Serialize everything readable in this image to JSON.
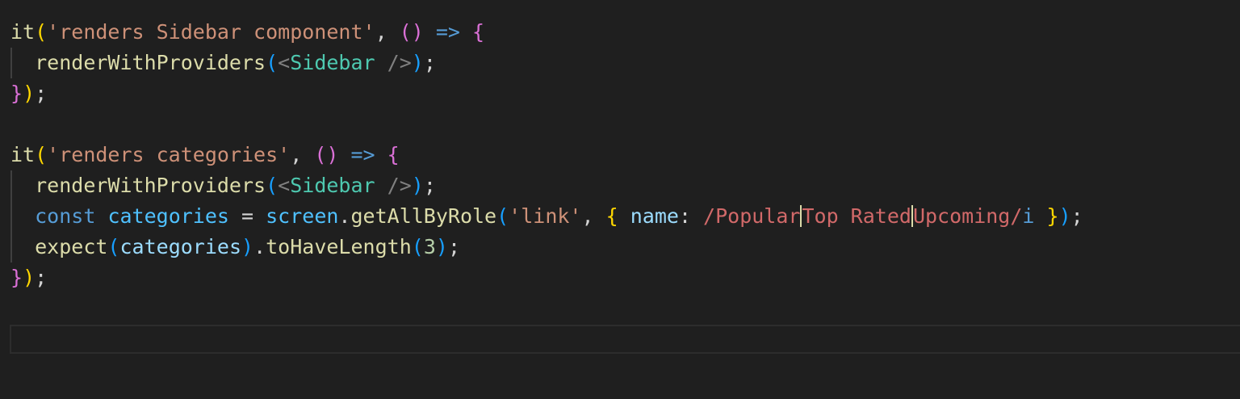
{
  "editor": {
    "theme_colors": {
      "background": "#1f1f1f",
      "function": "#dcdcaa",
      "string": "#ce9178",
      "keyword": "#569cd6",
      "variable": "#9cdcfe",
      "component": "#4ec9b0",
      "number": "#b5cea8",
      "regex": "#d16969",
      "bracket_gold": "#ffd700",
      "bracket_pink": "#da70d6",
      "bracket_blue": "#179fff",
      "text": "#d4d4d4"
    },
    "lines": [
      [
        {
          "text": "it",
          "color": "#dcdcaa"
        },
        {
          "text": "(",
          "color": "#ffd700"
        },
        {
          "text": "'renders Sidebar component'",
          "color": "#ce9178"
        },
        {
          "text": ", ",
          "color": "#d4d4d4"
        },
        {
          "text": "()",
          "color": "#da70d6"
        },
        {
          "text": " ",
          "color": "#d4d4d4"
        },
        {
          "text": "=>",
          "color": "#569cd6"
        },
        {
          "text": " ",
          "color": "#d4d4d4"
        },
        {
          "text": "{",
          "color": "#da70d6"
        }
      ],
      [
        {
          "text": "  ",
          "color": "#d4d4d4"
        },
        {
          "text": "renderWithProviders",
          "color": "#dcdcaa"
        },
        {
          "text": "(",
          "color": "#179fff"
        },
        {
          "text": "<",
          "color": "#808080"
        },
        {
          "text": "Sidebar",
          "color": "#4ec9b0"
        },
        {
          "text": " ",
          "color": "#d4d4d4"
        },
        {
          "text": "/>",
          "color": "#808080"
        },
        {
          "text": ")",
          "color": "#179fff"
        },
        {
          "text": ";",
          "color": "#d4d4d4"
        }
      ],
      [
        {
          "text": "}",
          "color": "#da70d6"
        },
        {
          "text": ")",
          "color": "#ffd700"
        },
        {
          "text": ";",
          "color": "#d4d4d4"
        }
      ],
      [],
      [
        {
          "text": "it",
          "color": "#dcdcaa"
        },
        {
          "text": "(",
          "color": "#ffd700"
        },
        {
          "text": "'renders categories'",
          "color": "#ce9178"
        },
        {
          "text": ", ",
          "color": "#d4d4d4"
        },
        {
          "text": "()",
          "color": "#da70d6"
        },
        {
          "text": " ",
          "color": "#d4d4d4"
        },
        {
          "text": "=>",
          "color": "#569cd6"
        },
        {
          "text": " ",
          "color": "#d4d4d4"
        },
        {
          "text": "{",
          "color": "#da70d6"
        }
      ],
      [
        {
          "text": "  ",
          "color": "#d4d4d4"
        },
        {
          "text": "renderWithProviders",
          "color": "#dcdcaa"
        },
        {
          "text": "(",
          "color": "#179fff"
        },
        {
          "text": "<",
          "color": "#808080"
        },
        {
          "text": "Sidebar",
          "color": "#4ec9b0"
        },
        {
          "text": " ",
          "color": "#d4d4d4"
        },
        {
          "text": "/>",
          "color": "#808080"
        },
        {
          "text": ")",
          "color": "#179fff"
        },
        {
          "text": ";",
          "color": "#d4d4d4"
        }
      ],
      [
        {
          "text": "  ",
          "color": "#d4d4d4"
        },
        {
          "text": "const",
          "color": "#569cd6"
        },
        {
          "text": " ",
          "color": "#d4d4d4"
        },
        {
          "text": "categories",
          "color": "#4fc1ff"
        },
        {
          "text": " = ",
          "color": "#d4d4d4"
        },
        {
          "text": "screen",
          "color": "#4fc1ff"
        },
        {
          "text": ".",
          "color": "#d4d4d4"
        },
        {
          "text": "getAllByRole",
          "color": "#dcdcaa"
        },
        {
          "text": "(",
          "color": "#179fff"
        },
        {
          "text": "'link'",
          "color": "#ce9178"
        },
        {
          "text": ", ",
          "color": "#d4d4d4"
        },
        {
          "text": "{",
          "color": "#ffd700"
        },
        {
          "text": " ",
          "color": "#d4d4d4"
        },
        {
          "text": "name",
          "color": "#9cdcfe"
        },
        {
          "text": ": ",
          "color": "#d4d4d4"
        },
        {
          "text": "/Popular",
          "color": "#d16969"
        },
        {
          "sep": true,
          "color": "#dcdcaa"
        },
        {
          "text": "Top Rated",
          "color": "#d16969"
        },
        {
          "sep": true,
          "color": "#dcdcaa"
        },
        {
          "text": "Upcoming/",
          "color": "#d16969"
        },
        {
          "text": "i",
          "color": "#569cd6"
        },
        {
          "text": " ",
          "color": "#d4d4d4"
        },
        {
          "text": "}",
          "color": "#ffd700"
        },
        {
          "text": ")",
          "color": "#179fff"
        },
        {
          "text": ";",
          "color": "#d4d4d4"
        }
      ],
      [
        {
          "text": "  ",
          "color": "#d4d4d4"
        },
        {
          "text": "expect",
          "color": "#dcdcaa"
        },
        {
          "text": "(",
          "color": "#179fff"
        },
        {
          "text": "categories",
          "color": "#9cdcfe"
        },
        {
          "text": ")",
          "color": "#179fff"
        },
        {
          "text": ".",
          "color": "#d4d4d4"
        },
        {
          "text": "toHaveLength",
          "color": "#dcdcaa"
        },
        {
          "text": "(",
          "color": "#179fff"
        },
        {
          "text": "3",
          "color": "#b5cea8"
        },
        {
          "text": ")",
          "color": "#179fff"
        },
        {
          "text": ";",
          "color": "#d4d4d4"
        }
      ],
      [
        {
          "text": "}",
          "color": "#da70d6"
        },
        {
          "text": ")",
          "color": "#ffd700"
        },
        {
          "text": ";",
          "color": "#d4d4d4"
        }
      ]
    ]
  }
}
